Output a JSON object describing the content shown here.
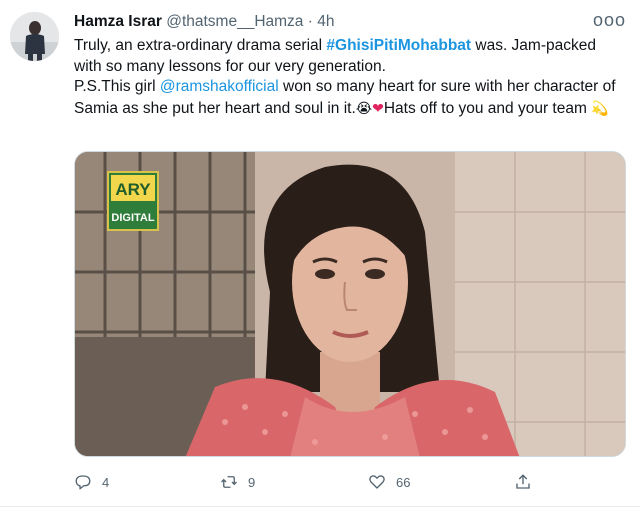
{
  "tweet": {
    "author_name": "Hamza Israr",
    "author_handle": "@thatsme__Hamza",
    "separator": "·",
    "timestamp": "4h",
    "more_label": "ooo",
    "body": {
      "line1_prefix": "Truly, an extra-ordinary drama serial ",
      "hashtag": "#GhisiPitiMohabbat",
      "line1_suffix": " was. Jam-packed with so many lessons for our very generation.",
      "line2_prefix": "P.S.This girl ",
      "mention": "@ramshakofficial",
      "line2_middle": "  won so many heart for sure with her character of Samia as she put her heart and soul in it.",
      "emoji_crying": "😭",
      "emoji_heart": "❤",
      "line2_suffix": "Hats off to you and your team ",
      "emoji_dizzy": "💫"
    },
    "media": {
      "logo_top": "ARY",
      "logo_bottom": "DIGITAL"
    },
    "actions": {
      "reply_count": "4",
      "retweet_count": "9",
      "like_count": "66"
    },
    "colors": {
      "link": "#1b95e0",
      "secondary_text": "#536471",
      "primary_text": "#0f1419"
    }
  }
}
